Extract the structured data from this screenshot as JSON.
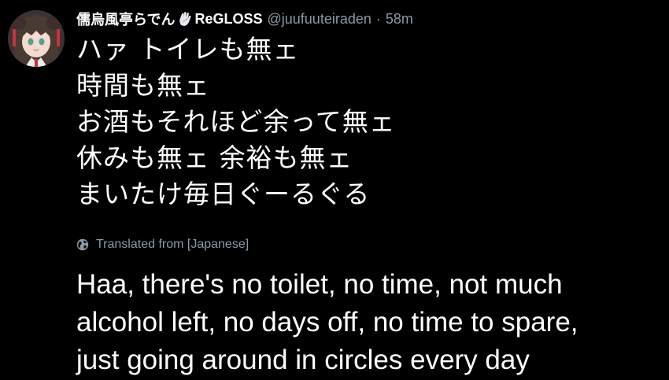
{
  "tweet": {
    "author": {
      "display_name": "儒烏風亭らでん",
      "badge_icon": "hand-icon",
      "affiliation": "ReGLOSS",
      "handle": "@juufuuteiraden",
      "separator": "·",
      "time": "58m"
    },
    "original_lines": [
      "ハァ トイレも無ェ",
      "時間も無ェ",
      "お酒もそれほど余って無ェ",
      "休みも無ェ 余裕も無ェ",
      "まいたけ毎日ぐーるぐる"
    ],
    "translated_from": "Translated from [Japanese]",
    "translation_lines": [
      "Haa, there's no toilet, no time, not much",
      "alcohol left, no days off, no time to spare,",
      "just going around in circles every day"
    ]
  },
  "colors": {
    "background": "#000000",
    "text_primary": "#ffffff",
    "text_secondary": "#8b98a5"
  }
}
